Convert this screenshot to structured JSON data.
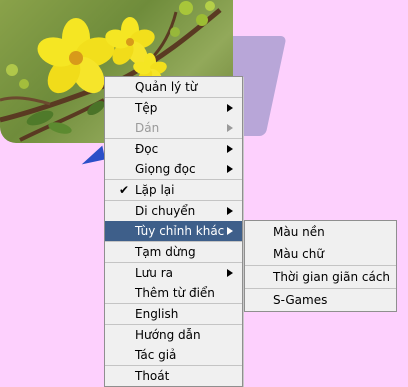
{
  "menu": {
    "items": [
      {
        "label": "Quản lý từ"
      },
      {
        "label": "Tệp"
      },
      {
        "label": "Dán"
      },
      {
        "label": "Đọc"
      },
      {
        "label": "Giọng đọc"
      },
      {
        "label": "Lặp lại",
        "checked": true
      },
      {
        "label": "Di chuyển"
      },
      {
        "label": "Tùy chỉnh khác"
      },
      {
        "label": "Tạm dừng"
      },
      {
        "label": "Lưu ra"
      },
      {
        "label": "Thêm từ điển"
      },
      {
        "label": "English"
      },
      {
        "label": "Hướng dẫn"
      },
      {
        "label": "Tác giả"
      },
      {
        "label": "Thoát"
      }
    ],
    "check_glyph": "✔"
  },
  "submenu": {
    "items": [
      {
        "label": "Màu nền"
      },
      {
        "label": "Màu chữ"
      },
      {
        "label": "Thời gian giãn cách"
      },
      {
        "label": "S-Games"
      }
    ]
  },
  "colors": {
    "background": "#fdd0fd",
    "highlight": "#3e5f8a",
    "flower": "#f5e623"
  }
}
